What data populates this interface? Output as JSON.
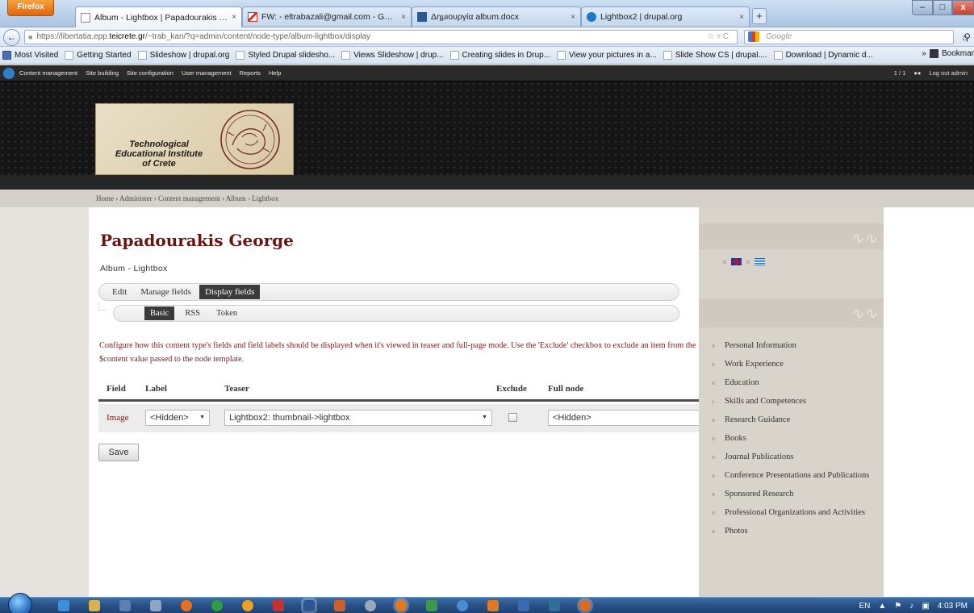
{
  "browser": {
    "firefox_label": "Firefox",
    "tabs": [
      {
        "title": "Album - Lightbox | Papadourakis Geo...",
        "close": "×"
      },
      {
        "title": "FW: - eltrabazali@gmail.com - Gmail",
        "close": "×"
      },
      {
        "title": "Δημιουργία album.docx",
        "close": "×"
      },
      {
        "title": "Lightbox2 | drupal.org",
        "close": "×"
      }
    ],
    "new_tab": "+",
    "window_controls": {
      "minimize": "–",
      "maximize": "□",
      "close": "x"
    },
    "back": "←",
    "url_prefix": "https://libertatia.epp.",
    "url_host": "teicrete.gr",
    "url_path": "/~trab_kan/?q=admin/content/node-type/album-lightbox/display",
    "url_icons": "☆ ▿ C",
    "search_placeholder": "Google",
    "search_icon": "search-icon",
    "home_icon": "home-icon",
    "bookmarks": [
      "Most Visited",
      "Getting Started",
      "Slideshow | drupal.org",
      "Styled Drupal slidesho...",
      "Views Slideshow | drup...",
      "Creating slides in Drup...",
      "View your pictures in a...",
      "Slide Show CS | drupal....",
      "Download | Dynamic d..."
    ],
    "bookmarks_more": "»",
    "bookmarks_menu": "Bookmar"
  },
  "admin_menu": {
    "items": [
      "Content management",
      "Site building",
      "Site configuration",
      "User management",
      "Reports",
      "Help"
    ],
    "user_count": "1 / 1",
    "logout": "Log out admin"
  },
  "header": {
    "logo_lines": [
      "Technological",
      "Educational Institute",
      "of Crete"
    ]
  },
  "breadcrumb": "Home › Administer › Content management › Album - Lightbox",
  "main": {
    "title": "Papadourakis George",
    "subtitle": "Album - Lightbox",
    "primary_tabs": [
      "Edit",
      "Manage fields",
      "Display fields"
    ],
    "secondary_tabs": [
      "Basic",
      "RSS",
      "Token"
    ],
    "description": "Configure how this content type's fields and field labels should be displayed when it's viewed in teaser and full-page mode. Use the 'Exclude' checkbox to exclude an item from the $content value passed to the node template.",
    "table": {
      "headers": {
        "field": "Field",
        "label": "Label",
        "teaser": "Teaser",
        "exclude": "Exclude",
        "full_node": "Full node"
      },
      "row": {
        "field": "Image",
        "label": "<Hidden>",
        "teaser": "Lightbox2: thumbnail->lightbox",
        "exclude": false,
        "full_node": "<Hidden>"
      }
    },
    "save": "Save"
  },
  "sidebar": {
    "menu": [
      "Personal Information",
      "Work Experience",
      "Education",
      "Skills and Competences",
      "Research Guidance",
      "Books",
      "Journal Publications",
      "Conference Presentations and Publications",
      "Sponsored Research",
      "Professional Organizations and Activities",
      "Photos"
    ]
  },
  "taskbar": {
    "language": "EN",
    "time": "4:03 PM"
  },
  "colors": {
    "title": "#6a1414",
    "description": "#7a1a1a",
    "active_tab": "#3a3a3a",
    "sidebar": "#d8d3cb",
    "admin_bar": "#2a2a2a"
  }
}
